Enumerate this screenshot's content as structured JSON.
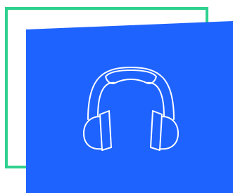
{
  "illustration": {
    "icon": "headphones-icon",
    "colors": {
      "frame": "#2fd08f",
      "panel": "#1f63ff",
      "icon_stroke": "#ffffff",
      "background": "#ffffff"
    }
  }
}
